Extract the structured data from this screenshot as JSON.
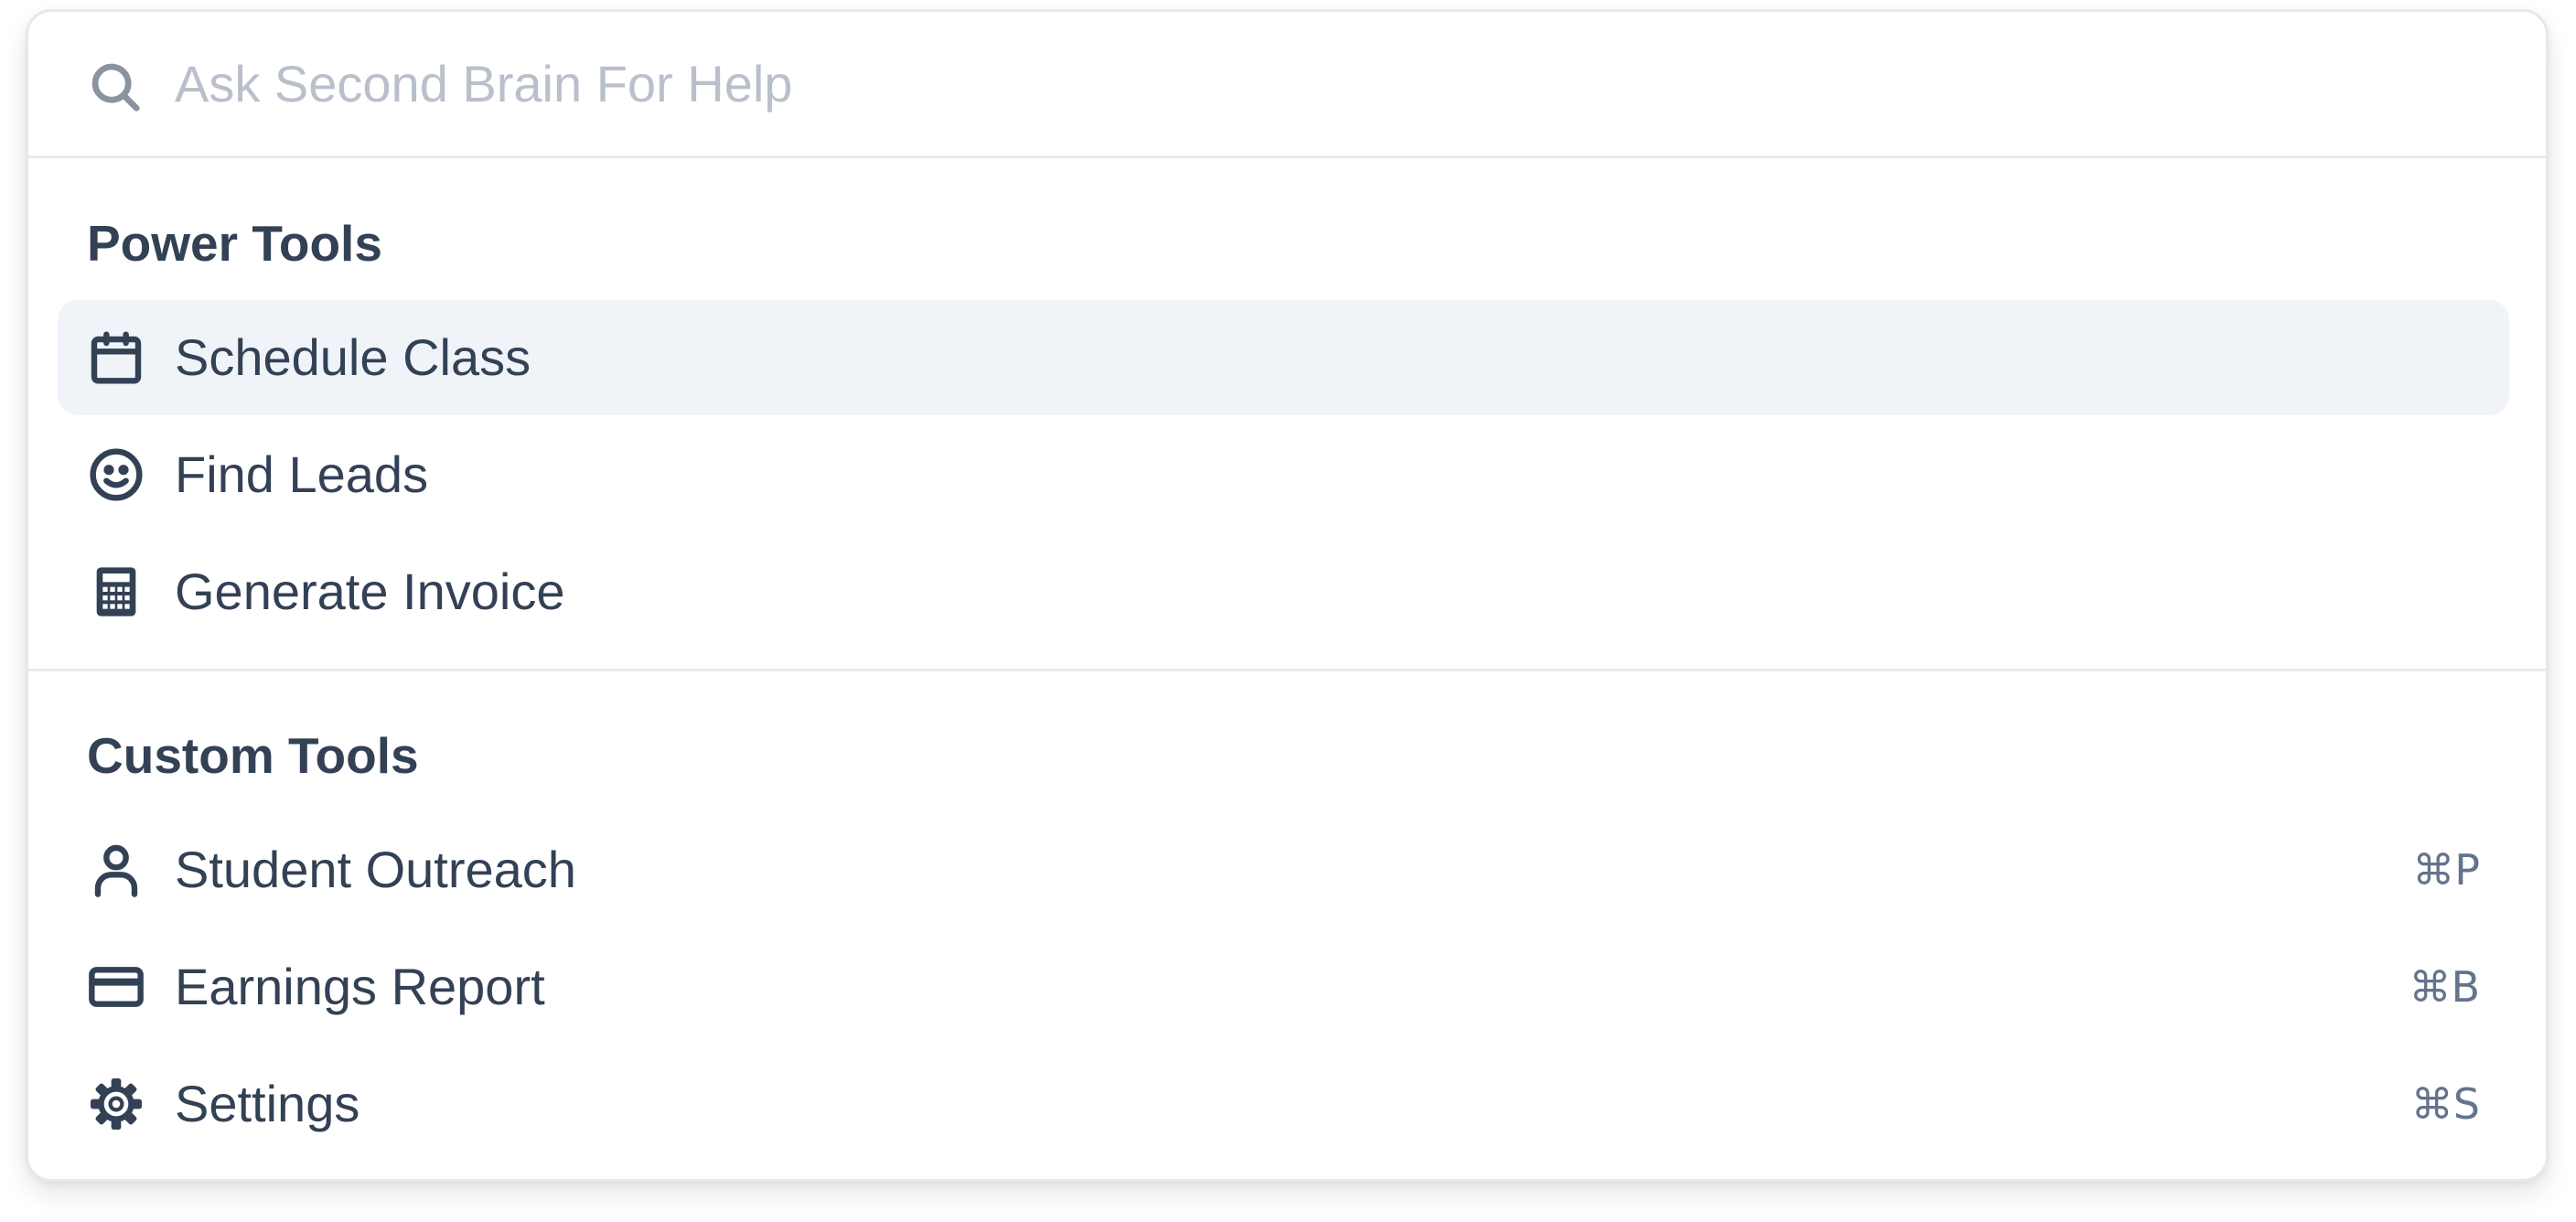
{
  "search": {
    "placeholder": "Ask Second Brain For Help",
    "value": ""
  },
  "sections": [
    {
      "heading": "Power Tools",
      "items": [
        {
          "label": "Schedule Class",
          "icon": "calendar-icon",
          "active": true
        },
        {
          "label": "Find Leads",
          "icon": "smiley-face-icon"
        },
        {
          "label": "Generate Invoice",
          "icon": "calculator-icon"
        }
      ]
    },
    {
      "heading": "Custom Tools",
      "items": [
        {
          "label": "Student Outreach",
          "icon": "user-icon",
          "shortcut": "⌘P"
        },
        {
          "label": "Earnings Report",
          "icon": "credit-card-icon",
          "shortcut": "⌘B"
        },
        {
          "label": "Settings",
          "icon": "gear-icon",
          "shortcut": "⌘S"
        }
      ]
    }
  ],
  "colors": {
    "text": "#334155",
    "placeholder": "#b9c0cb",
    "active_bg": "#f0f3f8",
    "shortcut": "#64748b",
    "border": "#e5e8ee"
  }
}
